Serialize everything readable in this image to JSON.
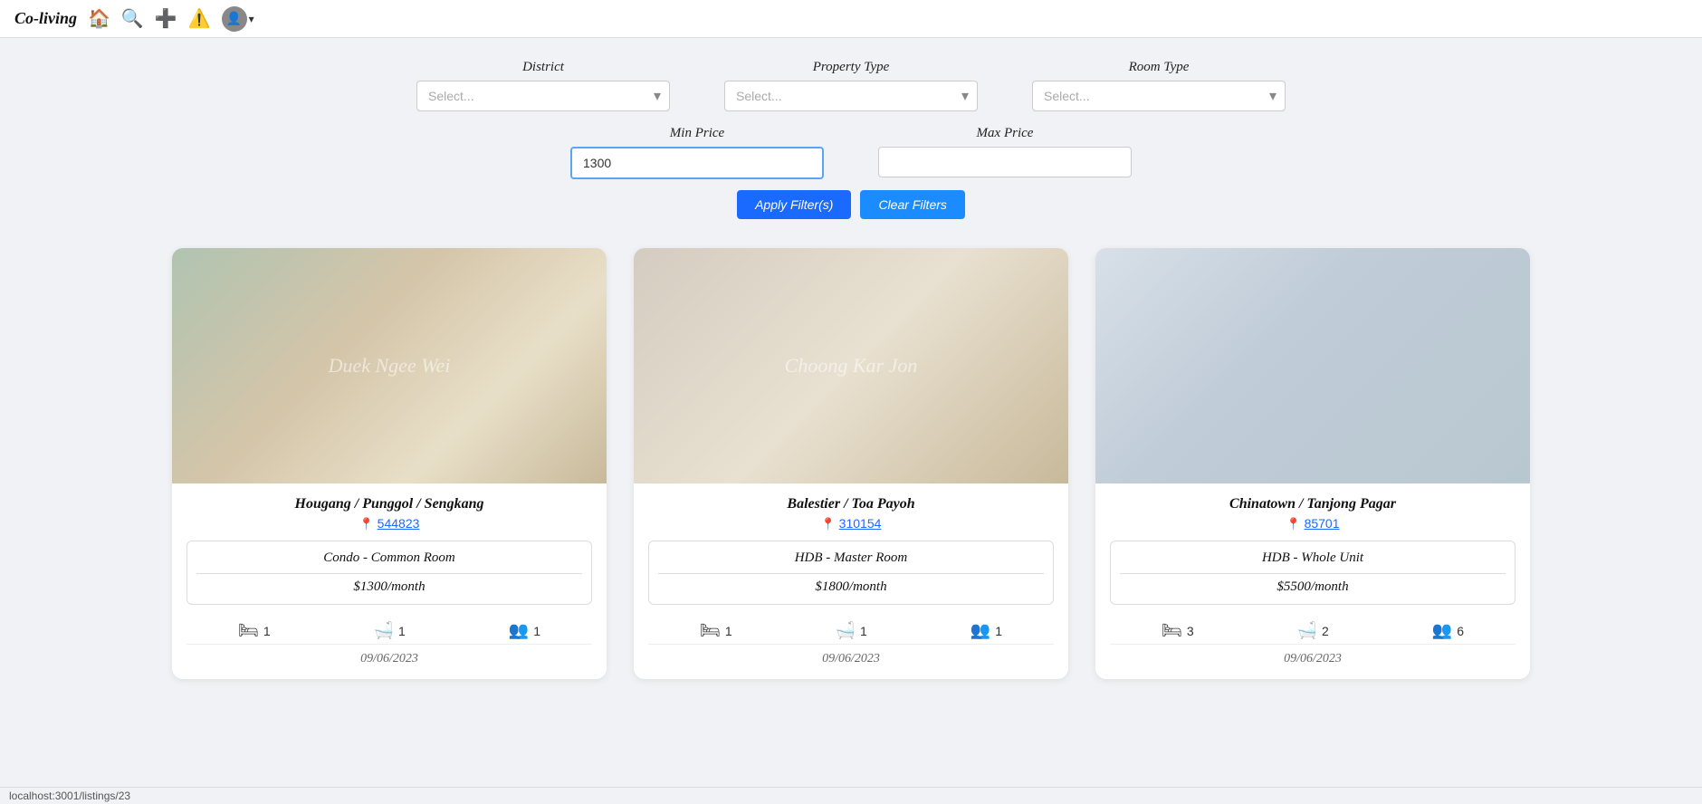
{
  "navbar": {
    "brand": "Co-living",
    "icons": [
      "home-icon",
      "search-icon",
      "add-icon",
      "alert-icon"
    ],
    "avatar_label": "User Avatar"
  },
  "filters": {
    "district_label": "District",
    "district_placeholder": "Select...",
    "property_type_label": "Property Type",
    "property_type_placeholder": "Select...",
    "room_type_label": "Room Type",
    "room_type_placeholder": "Select...",
    "min_price_label": "Min Price",
    "min_price_value": "1300",
    "max_price_label": "Max Price",
    "max_price_value": "",
    "apply_button": "Apply Filter(s)",
    "clear_button": "Clear Filters"
  },
  "listings": [
    {
      "location": "Hougang / Punggol / Sengkang",
      "postal": "544823",
      "watermark": "Duek Ngee Wei",
      "property_type": "Condo - Common Room",
      "price": "$1300/month",
      "beds": "1",
      "baths": "1",
      "persons": "1",
      "date": "09/06/2023",
      "img_class": "room-img-1"
    },
    {
      "location": "Balestier / Toa Payoh",
      "postal": "310154",
      "watermark": "Choong Kar Jon",
      "property_type": "HDB - Master Room",
      "price": "$1800/month",
      "beds": "1",
      "baths": "1",
      "persons": "1",
      "date": "09/06/2023",
      "img_class": "room-img-2"
    },
    {
      "location": "Chinatown / Tanjong Pagar",
      "postal": "85701",
      "watermark": "",
      "property_type": "HDB - Whole Unit",
      "price": "$5500/month",
      "beds": "3",
      "baths": "2",
      "persons": "6",
      "date": "09/06/2023",
      "img_class": "room-img-3"
    }
  ],
  "statusbar": {
    "text": "localhost:3001/listings/23"
  }
}
